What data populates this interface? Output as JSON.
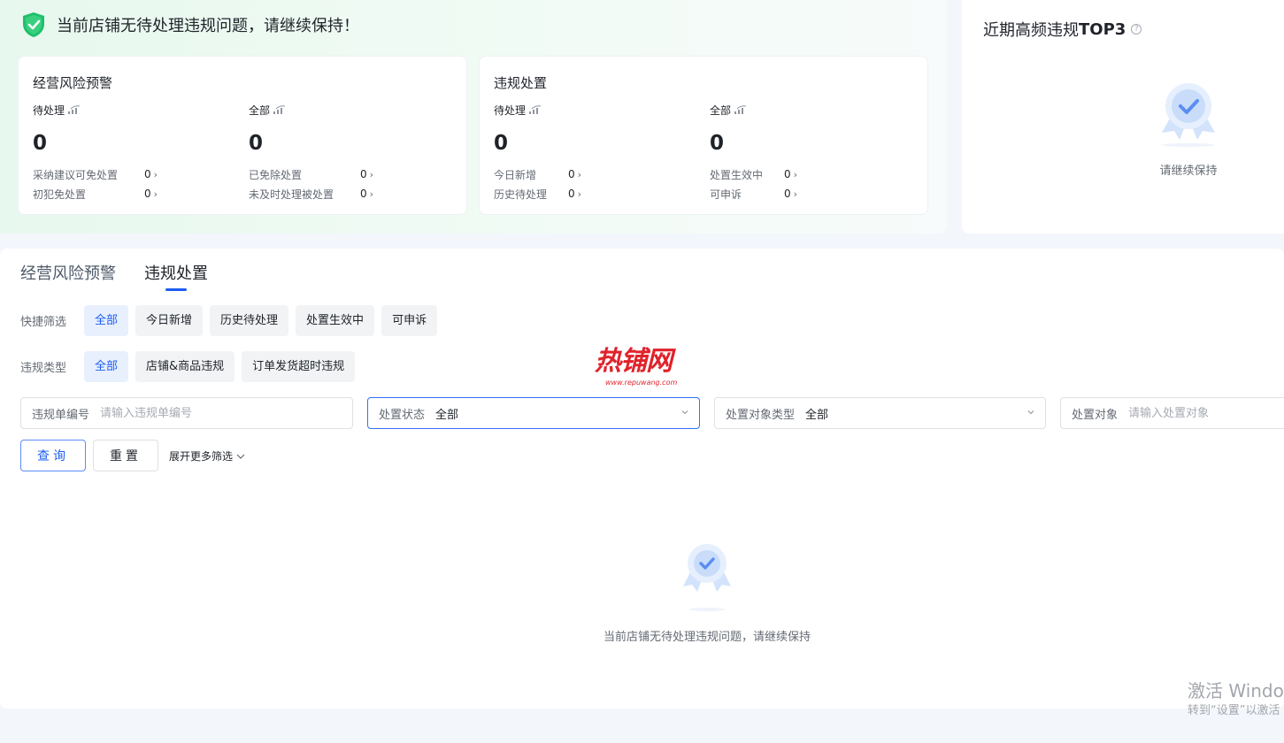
{
  "banner": {
    "text": "当前店铺无待处理违规问题，请继续保持！"
  },
  "risk_panel": {
    "title": "经营风险预警",
    "pending": {
      "label": "待处理",
      "value": "0",
      "rows": [
        {
          "label": "采纳建议可免处置",
          "value": "0"
        },
        {
          "label": "初犯免处置",
          "value": "0"
        }
      ]
    },
    "all": {
      "label": "全部",
      "value": "0",
      "rows": [
        {
          "label": "已免除处置",
          "value": "0"
        },
        {
          "label": "未及时处理被处置",
          "value": "0"
        }
      ]
    }
  },
  "violation_panel": {
    "title": "违规处置",
    "pending": {
      "label": "待处理",
      "value": "0",
      "rows": [
        {
          "label": "今日新增",
          "value": "0"
        },
        {
          "label": "历史待处理",
          "value": "0"
        }
      ]
    },
    "all": {
      "label": "全部",
      "value": "0",
      "rows": [
        {
          "label": "处置生效中",
          "value": "0"
        },
        {
          "label": "可申诉",
          "value": "0"
        }
      ]
    }
  },
  "top3": {
    "title_prefix": "近期高频违规",
    "title_bold": "TOP3",
    "help_glyph": "?",
    "empty_text": "请继续保持"
  },
  "tabs": [
    {
      "label": "经营风险预警",
      "active": false
    },
    {
      "label": "违规处置",
      "active": true
    }
  ],
  "quick_filter": {
    "label": "快捷筛选",
    "chips": [
      "全部",
      "今日新增",
      "历史待处理",
      "处置生效中",
      "可申诉"
    ],
    "selected": "全部"
  },
  "type_filter": {
    "label": "违规类型",
    "chips": [
      "全部",
      "店铺&商品违规",
      "订单发货超时违规"
    ],
    "selected": "全部"
  },
  "fields": {
    "order_no": {
      "label": "违规单编号",
      "placeholder": "请输入违规单编号"
    },
    "status": {
      "label": "处置状态",
      "value": "全部"
    },
    "object_type": {
      "label": "处置对象类型",
      "value": "全部"
    },
    "object": {
      "label": "处置对象",
      "placeholder": "请输入处置对象"
    }
  },
  "buttons": {
    "query": "查询",
    "reset": "重置",
    "more": "展开更多筛选"
  },
  "empty_state": {
    "text": "当前店铺无待处理违规问题，请继续保持"
  },
  "watermark": {
    "brand": "热铺网",
    "url": "www.repuwang.com"
  },
  "os_notice": {
    "line1": "激活 Windo",
    "line2": "转到“设置”以激活"
  },
  "colors": {
    "accent": "#1c5cf2",
    "success": "#1fbf6b",
    "watermark": "#e0222b"
  }
}
